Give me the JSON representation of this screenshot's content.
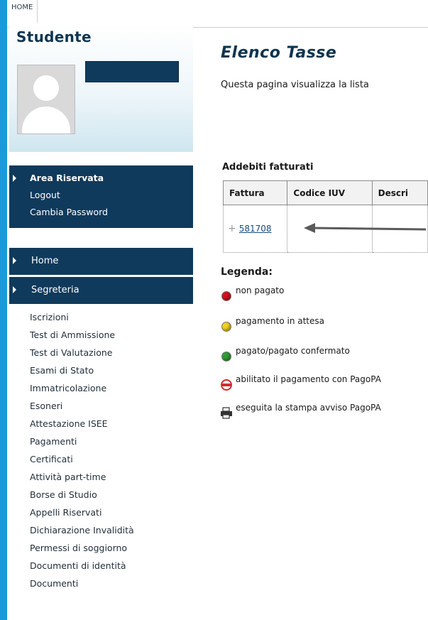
{
  "topbar": {
    "home_tab": "HOME"
  },
  "sidebar": {
    "student_title": "Studente",
    "area_riservata": {
      "title": "Area Riservata",
      "links": [
        "Logout",
        "Cambia Password"
      ]
    },
    "nav": [
      {
        "label": "Home"
      },
      {
        "label": "Segreteria"
      }
    ],
    "menu": [
      "Iscrizioni",
      "Test di Ammissione",
      "Test di Valutazione",
      "Esami di Stato",
      "Immatricolazione",
      "Esoneri",
      "Attestazione ISEE",
      "Pagamenti",
      "Certificati",
      "Attività part-time",
      "Borse di Studio",
      "Appelli Riservati",
      "Dichiarazione Invalidità",
      "Permessi di soggiorno",
      "Documenti di identità",
      "Documenti"
    ]
  },
  "main": {
    "title": "Elenco Tasse",
    "description": "Questa pagina visualizza la lista",
    "section_title": "Addebiti fatturati",
    "table": {
      "headers": [
        "Fattura",
        "Codice IUV",
        "Descri"
      ],
      "rows": [
        {
          "fattura": "581708",
          "codice_iuv": "",
          "descrizione": ""
        }
      ]
    },
    "legend": {
      "title": "Legenda:",
      "items": [
        {
          "icon": "red-dot-icon",
          "color": "#d0141e",
          "label": "non pagato"
        },
        {
          "icon": "yellow-dot-icon",
          "color": "#f2d21b",
          "label": "pagamento in attesa"
        },
        {
          "icon": "green-dot-icon",
          "color": "#2e9e35",
          "label": "pagato/pagato confermato"
        },
        {
          "icon": "pagopa-icon",
          "color": "#d62b2b",
          "label": "abilitato il pagamento con PagoPA"
        },
        {
          "icon": "printer-icon",
          "color": "#333333",
          "label": "eseguita la stampa avviso PagoPA"
        }
      ]
    }
  },
  "colors": {
    "frame": "#1a9bd7",
    "nav_background": "#0f3a5c",
    "title": "#0f3550"
  }
}
